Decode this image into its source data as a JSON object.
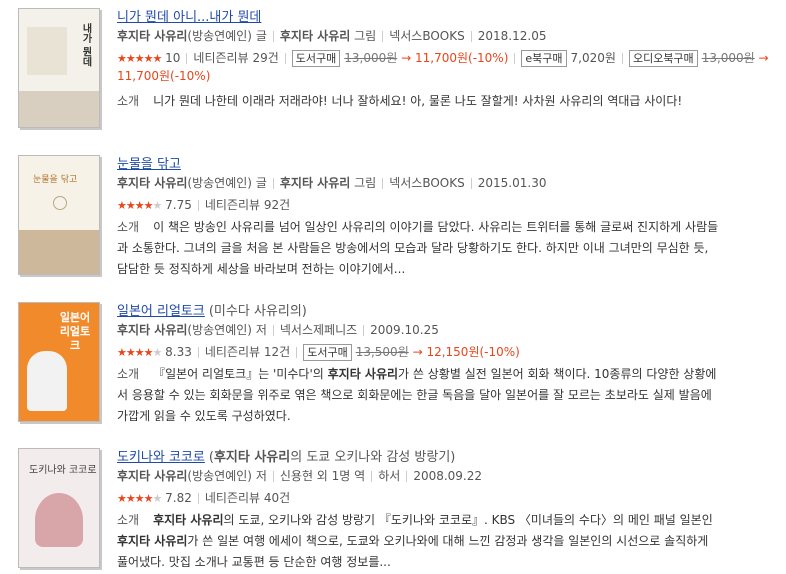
{
  "items": [
    {
      "title": "니가 뭔데 아니...내가 뭔데",
      "author": "후지타 사유리",
      "author_note": "(방송연예인)",
      "author_role": "글",
      "illustrator": "후지타 사유리",
      "illustrator_role": "그림",
      "publisher": "넥서스BOOKS",
      "date": "2018.12.05",
      "rating": "10",
      "review_label": "네티즌리뷰",
      "review_count": "29건",
      "badge_print": "도서구매",
      "price_original": "13,000원",
      "price_sale": "11,700원(-10%)",
      "badge_ebook": "e북구매",
      "ebook_price": "7,020원",
      "badge_audio": "오디오북구매",
      "audio_original": "13,000원",
      "audio_sale": "11,700원(-10%)",
      "arrow": "→",
      "desc_label": "소개",
      "desc": "니가 뭔데 나한테 이래라 저래라야! 너나 잘하세요! 아, 물론 나도 잘할게! 사차원 사유리의 역대급 사이다!",
      "cover_text": "내가 뭔데"
    },
    {
      "title": "눈물을 닦고",
      "author": "후지타 사유리",
      "author_note": "(방송연예인)",
      "author_role": "글",
      "illustrator": "후지타 사유리",
      "illustrator_role": "그림",
      "publisher": "넥서스BOOKS",
      "date": "2015.01.30",
      "rating": "7.75",
      "review_label": "네티즌리뷰",
      "review_count": "92건",
      "desc_label": "소개",
      "desc_1": "이 책은 방송인 사유리를 넘어 일상인 사유리의 이야기를 담았다. 사유리는 트위터를 통해 글로써 진지하게 사람들",
      "desc_2": "과 소통한다. 그녀의 글을 처음 본 사람들은 방송에서의 모습과 달라 당황하기도 한다. 하지만 이내 그녀만의 무심한 듯,",
      "desc_3": "담담한 듯 정직하게 세상을 바라보며 전하는 이야기에서...",
      "cover_text": "눈물을 닦고"
    },
    {
      "title": "일본어 리얼토크",
      "subtitle": "(미수다 사유리의)",
      "author": "후지타 사유리",
      "author_note": "(방송연예인)",
      "author_role": "저",
      "publisher": "넥서스제페니즈",
      "date": "2009.10.25",
      "rating": "8.33",
      "review_label": "네티즌리뷰",
      "review_count": "12건",
      "badge_print": "도서구매",
      "price_original": "13,500원",
      "price_sale": "12,150원(-10%)",
      "arrow": "→",
      "desc_label": "소개",
      "desc_1a": "『일본어 리얼토크』는 '미수다'의 ",
      "desc_1b": "후지타 사유리",
      "desc_1c": "가 쓴 상황별 실전 일본어 회화 책이다. 10종류의 다양한 상황에",
      "desc_2": "서 응용할 수 있는 회화문을 위주로 엮은 책으로 회화문에는 한글 독음을 달아 일본어를 잘 모르는 초보라도 실제 발음에",
      "desc_3": "가깝게 읽을 수 있도록 구성하였다.",
      "cover_text": "일본어 리얼토크"
    },
    {
      "title": "도키나와 코코로",
      "subtitle_a": "(",
      "subtitle_b": "후지타 사유리",
      "subtitle_c": "의 도쿄 오키나와 감성 방랑기)",
      "author": "후지타 사유리",
      "author_note": "(방송연예인)",
      "author_role": "저",
      "translator": "신용현 외 1명",
      "translator_role": "역",
      "publisher": "하서",
      "date": "2008.09.22",
      "rating": "7.82",
      "review_label": "네티즌리뷰",
      "review_count": "40건",
      "desc_label": "소개",
      "desc_1a": "후지타 사유리",
      "desc_1b": "의 도쿄, 오키나와 감성 방랑기 『도키나와 코코로』. KBS 〈미녀들의 수다〉의 메인 패널 일본인",
      "desc_2a": "후지타 사유리",
      "desc_2b": "가 쓴 일본 여행 에세이 책으로, 도쿄와 오키나와에 대해 느낀 감정과 생각을 일본인의 시선으로 솔직하게",
      "desc_3": "풀어냈다. 맛집 소개나 교통편 등 단순한 여행 정보를...",
      "cover_text": "도키나와 코코로"
    }
  ],
  "colors": {
    "accent": "#e8461b",
    "link": "#1f4aa8"
  }
}
